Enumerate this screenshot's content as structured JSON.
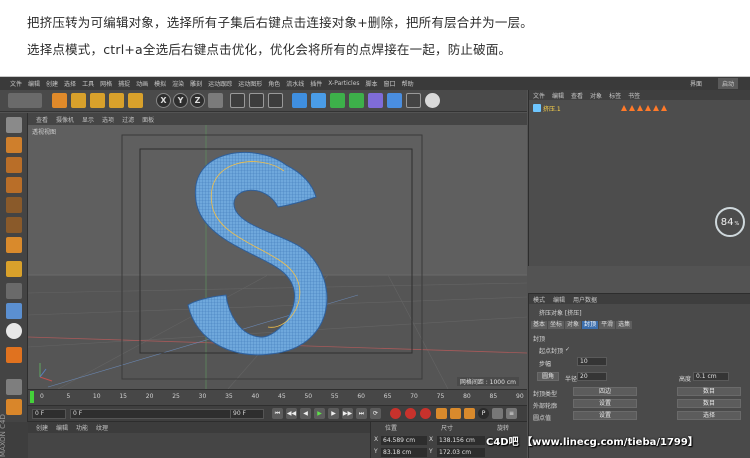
{
  "instructions": {
    "line1": "把挤压转为可编辑对象，选择所有子集后右键点击连接对象+删除，把所有层合并为一层。",
    "line2": "选择点模式，ctrl+a全选后右键点击优化，优化会将所有的点焊接在一起，防止破面。"
  },
  "app": {
    "menu": [
      "文件",
      "编辑",
      "创建",
      "选择",
      "工具",
      "网格",
      "捕捉",
      "动画",
      "模拟",
      "渲染",
      "雕刻",
      "运动跟踪",
      "运动图形",
      "角色",
      "流水线",
      "插件",
      "X-Particles",
      "脚本",
      "窗口",
      "帮助"
    ],
    "layout_tabs": [
      "界面",
      "启动"
    ],
    "toolbar_axes": [
      "X",
      "Y",
      "Z"
    ]
  },
  "viewport": {
    "menu": [
      "查看",
      "摄像机",
      "显示",
      "选项",
      "过滤",
      "面板"
    ],
    "label": "透视视图",
    "grid_spacing": "网格间距 : 1000 cm"
  },
  "timeline": {
    "ticks": [
      "0",
      "5",
      "10",
      "15",
      "20",
      "25",
      "30",
      "35",
      "40",
      "45",
      "50",
      "55",
      "60",
      "65",
      "70",
      "75",
      "80",
      "85",
      "90"
    ],
    "current_frame": "0 F",
    "start_frame": "0 F",
    "end_frame": "90 F",
    "right_frame": "0 F"
  },
  "material_menu": [
    "创建",
    "编辑",
    "功能",
    "纹理"
  ],
  "coordinates": {
    "headers": [
      "位置",
      "尺寸",
      "旋转"
    ],
    "rows": [
      {
        "axis": "X",
        "pos": "64.589 cm",
        "size_axis": "X",
        "size": "138.156 cm"
      },
      {
        "axis": "Y",
        "pos": "83.18 cm",
        "size_axis": "Y",
        "size": "172.03 cm"
      }
    ]
  },
  "object_manager": {
    "menu": [
      "文件",
      "编辑",
      "查看",
      "对象",
      "标签",
      "书签"
    ],
    "object_name": "挤压.1",
    "fps": "84",
    "fps_unit": "%"
  },
  "attributes": {
    "menu": [
      "模式",
      "编辑",
      "用户数据"
    ],
    "object_line": "挤压对象 [挤压]",
    "tabs": [
      "基本",
      "坐标",
      "对象",
      "封顶",
      "平滑",
      "选集"
    ],
    "active_tab": "封顶",
    "section": "封顶",
    "start_label": "起点封顶",
    "start_check": "✓",
    "steps_label": "步幅",
    "steps_value": "10",
    "radius_label": "半径",
    "radius_value": "20",
    "fillet_label": "圆角",
    "height_label": "高度",
    "height_value": "0.1 cm",
    "rows": [
      {
        "label": "封顶类型",
        "button": "四边",
        "right": "数目"
      },
      {
        "label": "外部轮廓",
        "button": "设置",
        "right": "数目"
      },
      {
        "label": "圆点值",
        "button": "设置",
        "right": "选择"
      }
    ]
  },
  "watermark": "C4D吧 【www.linecg.com/tieba/1799】"
}
